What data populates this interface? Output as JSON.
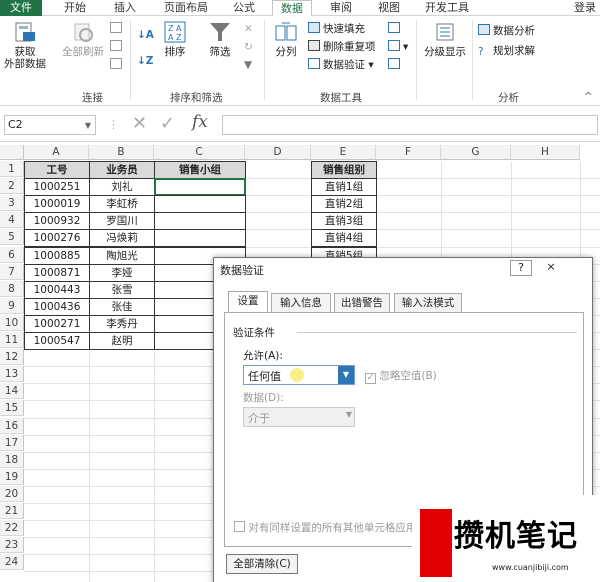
{
  "ribbon_tabs": [
    "文件",
    "开始",
    "插入",
    "页面布局",
    "公式",
    "数据",
    "审阅",
    "视图",
    "开发工具",
    "登录"
  ],
  "ribbon": {
    "get_external": "获取\n外部数据",
    "refresh_all": "全部刷新",
    "sort": "排序",
    "filter": "筛选",
    "split": "分列",
    "flash_fill": "快速填充",
    "remove_dup": "删除重复项",
    "validation": "数据验证",
    "outline": "分级显示",
    "data_analysis": "数据分析",
    "solver": "规划求解",
    "group_connections": "连接",
    "group_sort_filter": "排序和筛选",
    "group_data_tools": "数据工具",
    "group_analysis": "分析"
  },
  "formula_bar": {
    "name_box": "C2",
    "fx": "fx",
    "formula": ""
  },
  "sheet": {
    "columns": [
      "A",
      "B",
      "C",
      "D",
      "E",
      "F",
      "G",
      "H"
    ],
    "rows": [
      "1",
      "2",
      "3",
      "4",
      "5",
      "6",
      "7",
      "8",
      "9",
      "10",
      "11",
      "12",
      "13",
      "14",
      "15",
      "16",
      "17",
      "18",
      "19",
      "20",
      "21",
      "22",
      "23",
      "24"
    ],
    "headers": {
      "a": "工号",
      "b": "业务员",
      "c": "销售小组",
      "e": "销售组别"
    },
    "ids": [
      "1000251",
      "1000019",
      "1000932",
      "1000276",
      "1000885",
      "1000871",
      "1000443",
      "1000436",
      "1000271",
      "1000547"
    ],
    "names": [
      "刘礼",
      "李虹桥",
      "罗国川",
      "冯焕莉",
      "陶旭光",
      "李娅",
      "张雪",
      "张佳",
      "李秀丹",
      "赵明"
    ],
    "groups": [
      "直销1组",
      "直销2组",
      "直销3组",
      "直销4组",
      "直销5组"
    ]
  },
  "dialog": {
    "title": "数据验证",
    "help": "?",
    "close": "×",
    "tabs": [
      "设置",
      "输入信息",
      "出错警告",
      "输入法模式"
    ],
    "section": "验证条件",
    "allow_label": "允许(A):",
    "allow_value": "任何值",
    "ignore_blank": "忽略空值(B)",
    "data_label": "数据(D):",
    "data_value": "介于",
    "apply_all": "对有同样设置的所有其他单元格应用",
    "clear_all": "全部清除(C)"
  },
  "watermark": {
    "text": "攒机笔记",
    "url": "www.cuanjibiji.com"
  }
}
